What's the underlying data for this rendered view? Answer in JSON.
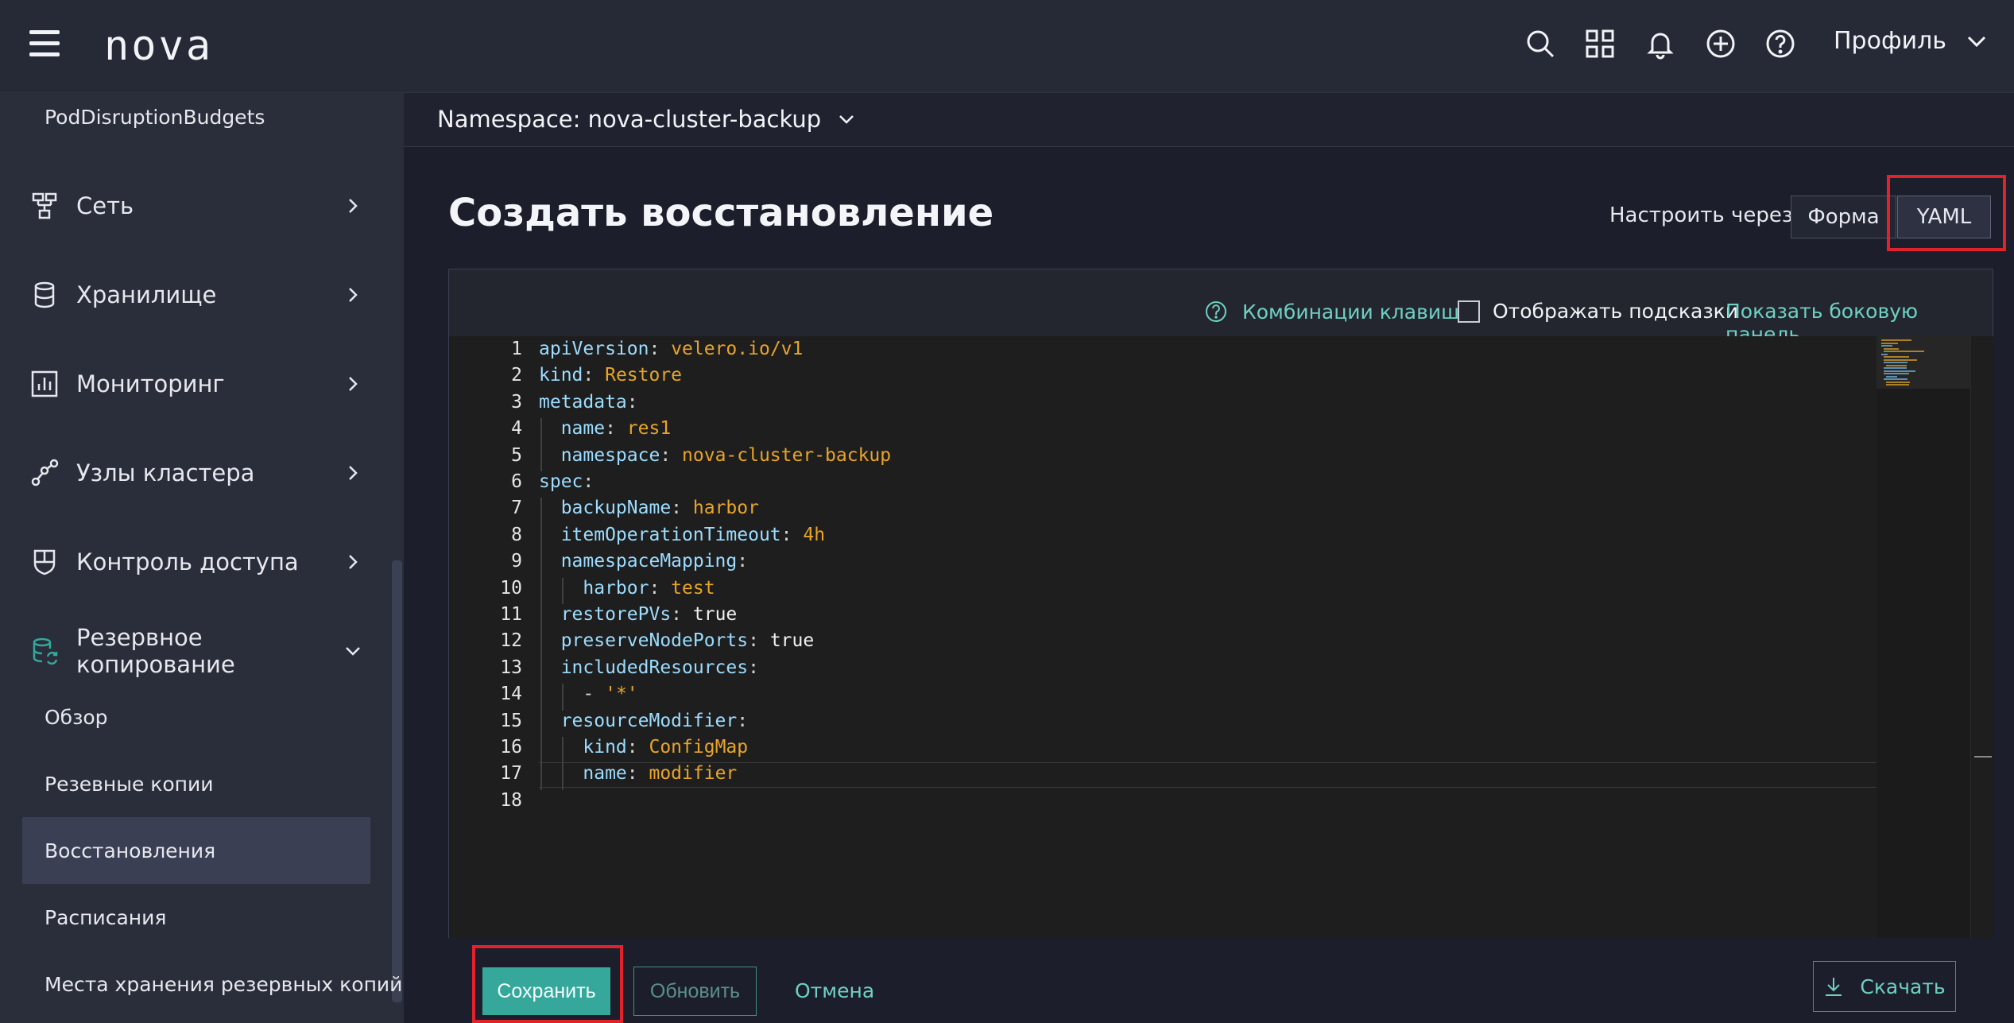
{
  "app": {
    "logo": "nova"
  },
  "topbar": {
    "icons": [
      "search-icon",
      "apps-grid-icon",
      "bell-icon",
      "plus-circle-icon",
      "help-icon"
    ],
    "profile_label": "Профиль"
  },
  "sidebar": {
    "top_sub_item": "PodDisruptionBudgets",
    "groups": [
      {
        "label": "Сеть",
        "icon": "network-icon"
      },
      {
        "label": "Хранилище",
        "icon": "database-icon"
      },
      {
        "label": "Мониторинг",
        "icon": "monitoring-chart-icon"
      },
      {
        "label": "Узлы кластера",
        "icon": "cluster-nodes-icon"
      },
      {
        "label": "Контроль доступа",
        "icon": "shield-icon"
      },
      {
        "label": "Резервное копирование",
        "icon": "backup-database-icon"
      }
    ],
    "backup_items": [
      {
        "label": "Обзор"
      },
      {
        "label": "Резевные копии"
      },
      {
        "label": "Восстановления",
        "active": true
      },
      {
        "label": "Расписания"
      },
      {
        "label": "Места хранения резервных копий"
      }
    ]
  },
  "namespace": {
    "label": "Namespace: nova-cluster-backup"
  },
  "page": {
    "title": "Создать восстановление",
    "configure_via_label": "Настроить через:",
    "mode_form": "Форма",
    "mode_yaml": "YAML",
    "selected_mode": "YAML"
  },
  "editor": {
    "shortcuts_label": "Комбинации клавиш",
    "hints_label": "Отображать подсказки",
    "hints_checked": false,
    "side_panel_label": "Показать боковую панель",
    "lines": [
      {
        "n": "1",
        "indent": 0,
        "key": "apiVersion",
        "value": "velero.io/v1",
        "value_type": "str"
      },
      {
        "n": "2",
        "indent": 0,
        "key": "kind",
        "value": "Restore",
        "value_type": "str"
      },
      {
        "n": "3",
        "indent": 0,
        "key": "metadata",
        "value": "",
        "value_type": "none"
      },
      {
        "n": "4",
        "indent": 1,
        "key": "name",
        "value": "res1",
        "value_type": "str"
      },
      {
        "n": "5",
        "indent": 1,
        "key": "namespace",
        "value": "nova-cluster-backup",
        "value_type": "str"
      },
      {
        "n": "6",
        "indent": 0,
        "key": "spec",
        "value": "",
        "value_type": "none"
      },
      {
        "n": "7",
        "indent": 1,
        "key": "backupName",
        "value": "harbor",
        "value_type": "str"
      },
      {
        "n": "8",
        "indent": 1,
        "key": "itemOperationTimeout",
        "value": "4h",
        "value_type": "str"
      },
      {
        "n": "9",
        "indent": 1,
        "key": "namespaceMapping",
        "value": "",
        "value_type": "none"
      },
      {
        "n": "10",
        "indent": 2,
        "key": "harbor",
        "value": "test",
        "value_type": "str"
      },
      {
        "n": "11",
        "indent": 1,
        "key": "restorePVs",
        "value": "true",
        "value_type": "bool"
      },
      {
        "n": "12",
        "indent": 1,
        "key": "preserveNodePorts",
        "value": "true",
        "value_type": "bool"
      },
      {
        "n": "13",
        "indent": 1,
        "key": "includedResources",
        "value": "",
        "value_type": "none"
      },
      {
        "n": "14",
        "indent": 2,
        "key": "",
        "value": "'*'",
        "value_type": "list"
      },
      {
        "n": "15",
        "indent": 1,
        "key": "resourceModifier",
        "value": "",
        "value_type": "none"
      },
      {
        "n": "16",
        "indent": 2,
        "key": "kind",
        "value": "ConfigMap",
        "value_type": "str"
      },
      {
        "n": "17",
        "indent": 2,
        "key": "name",
        "value": "modifier",
        "value_type": "str"
      },
      {
        "n": "18",
        "indent": 0,
        "key": "",
        "value": "",
        "value_type": "empty"
      }
    ]
  },
  "footer": {
    "save_label": "Сохранить",
    "update_label": "Обновить",
    "cancel_label": "Отмена",
    "download_label": "Скачать"
  },
  "colors": {
    "accent": "#36a89b",
    "link": "#6fd0c3",
    "highlight_box": "#e0232b",
    "yaml_key": "#9cdcfe",
    "yaml_value": "#e8a528"
  }
}
